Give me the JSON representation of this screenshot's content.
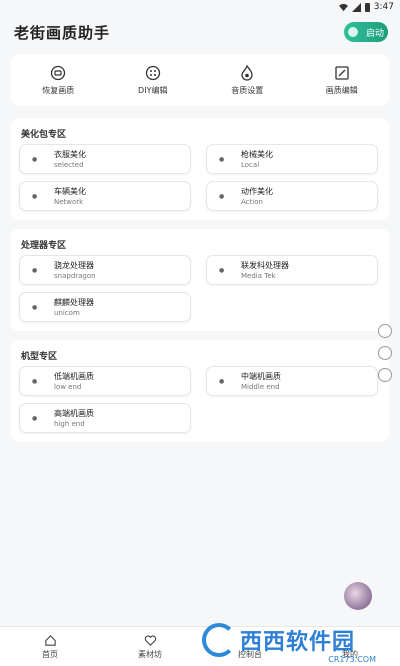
{
  "status": {
    "time": "3:47"
  },
  "header": {
    "title": "老街画质助手",
    "start_label": "启动"
  },
  "quickbar": [
    {
      "label": "恢复画质",
      "icon": "restore-icon"
    },
    {
      "label": "DIY编辑",
      "icon": "palette-icon"
    },
    {
      "label": "音质设置",
      "icon": "flame-icon"
    },
    {
      "label": "画质编辑",
      "icon": "edit-icon"
    }
  ],
  "sections": {
    "beautify": {
      "title": "美化包专区",
      "cards": [
        {
          "title": "衣服美化",
          "sub": "selected"
        },
        {
          "title": "枪械美化",
          "sub": "Local"
        },
        {
          "title": "车辆美化",
          "sub": "Network"
        },
        {
          "title": "动作美化",
          "sub": "Action"
        }
      ]
    },
    "processor": {
      "title": "处理器专区",
      "cards": [
        {
          "title": "骁龙处理器",
          "sub": "snapdragon"
        },
        {
          "title": "联发科处理器",
          "sub": "Media Tek"
        },
        {
          "title": "麒麟处理器",
          "sub": "unicom"
        }
      ]
    },
    "model": {
      "title": "机型专区",
      "cards": [
        {
          "title": "低端机画质",
          "sub": "low end"
        },
        {
          "title": "中端机画质",
          "sub": "Middle end"
        },
        {
          "title": "高端机画质",
          "sub": "high end"
        }
      ]
    }
  },
  "tabbar": [
    {
      "label": "首页",
      "icon": "home-icon"
    },
    {
      "label": "素材坊",
      "icon": "heart-icon"
    },
    {
      "label": "控制台",
      "icon": "console-icon"
    },
    {
      "label": "我的",
      "icon": "profile-icon"
    }
  ],
  "watermark": {
    "text": "西西软件园",
    "sub": "CR173.COM"
  },
  "colors": {
    "accent": "#1e9e7b",
    "watermark": "#2e7fd6"
  }
}
